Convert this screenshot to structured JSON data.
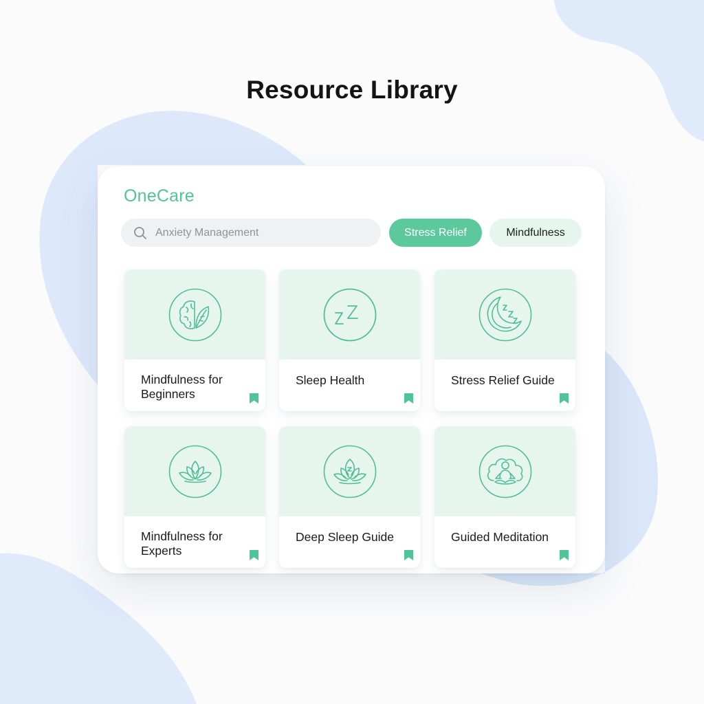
{
  "page": {
    "title": "Resource Library"
  },
  "app": {
    "brand": "OneCare"
  },
  "search": {
    "value": "Anxiety Management",
    "icon": "search-icon"
  },
  "filters": [
    {
      "label": "Stress Relief",
      "active": true
    },
    {
      "label": "Mindfulness",
      "active": false
    }
  ],
  "cards": [
    {
      "title": "Mindfulness for Beginners",
      "icon": "brain-leaf-icon"
    },
    {
      "title": "Sleep Health",
      "icon": "sleep-zz-icon"
    },
    {
      "title": "Stress Relief Guide",
      "icon": "moon-zz-icon"
    },
    {
      "title": "Mindfulness for Experts",
      "icon": "lotus-icon"
    },
    {
      "title": "Deep Sleep Guide",
      "icon": "lotus-sleep-icon"
    },
    {
      "title": "Guided Meditation",
      "icon": "meditation-person-icon"
    }
  ],
  "colors": {
    "accent": "#5bc89d",
    "brand_text": "#4fc597",
    "card_header": "#e6f5ee",
    "chip_idle": "#e6f6ee",
    "blob": "#dde9fb"
  }
}
